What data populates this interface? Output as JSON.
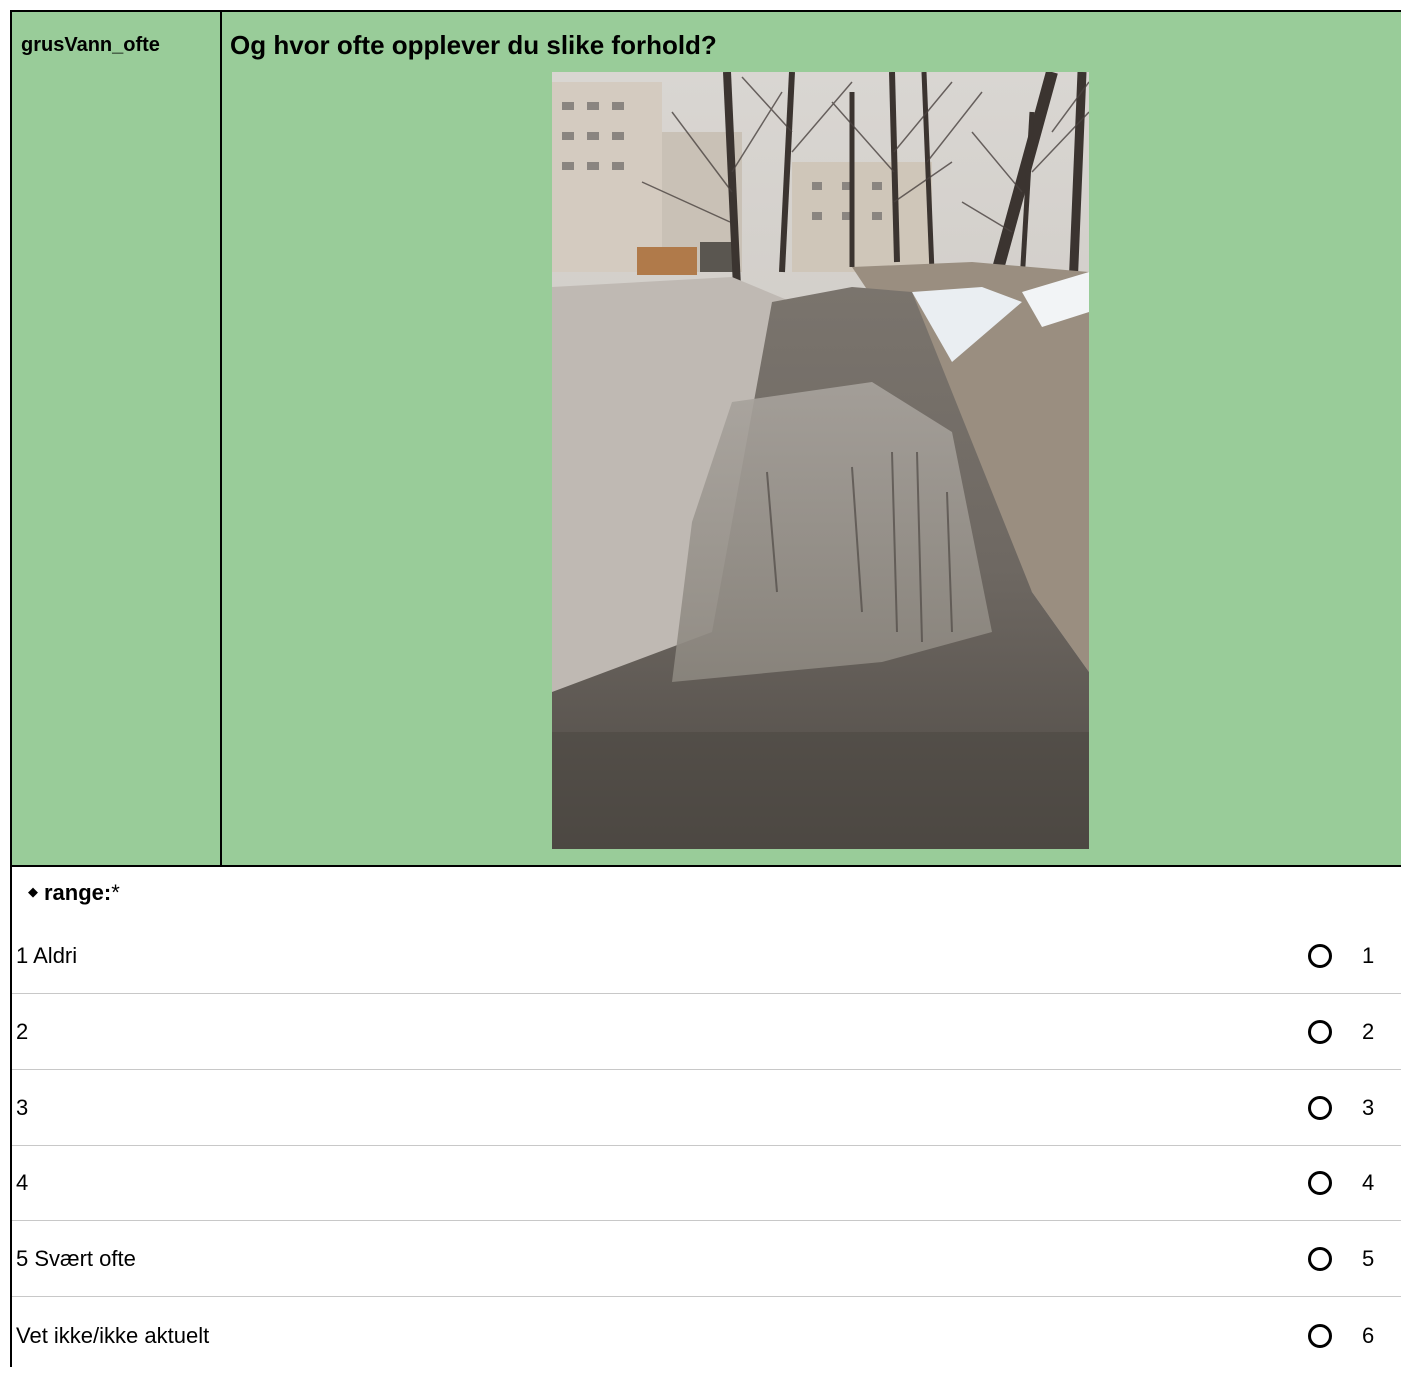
{
  "question": {
    "id": "grusVann_ofte",
    "text": "Og hvor ofte opplever du slike forhold?"
  },
  "range": {
    "label": "range:",
    "required_mark": "*"
  },
  "options": [
    {
      "label": "1 Aldri",
      "value": "1"
    },
    {
      "label": "2",
      "value": "2"
    },
    {
      "label": "3",
      "value": "3"
    },
    {
      "label": "4",
      "value": "4"
    },
    {
      "label": "5 Svært ofte",
      "value": "5"
    },
    {
      "label": "Vet ikke/ikke aktuelt",
      "value": "6"
    }
  ]
}
